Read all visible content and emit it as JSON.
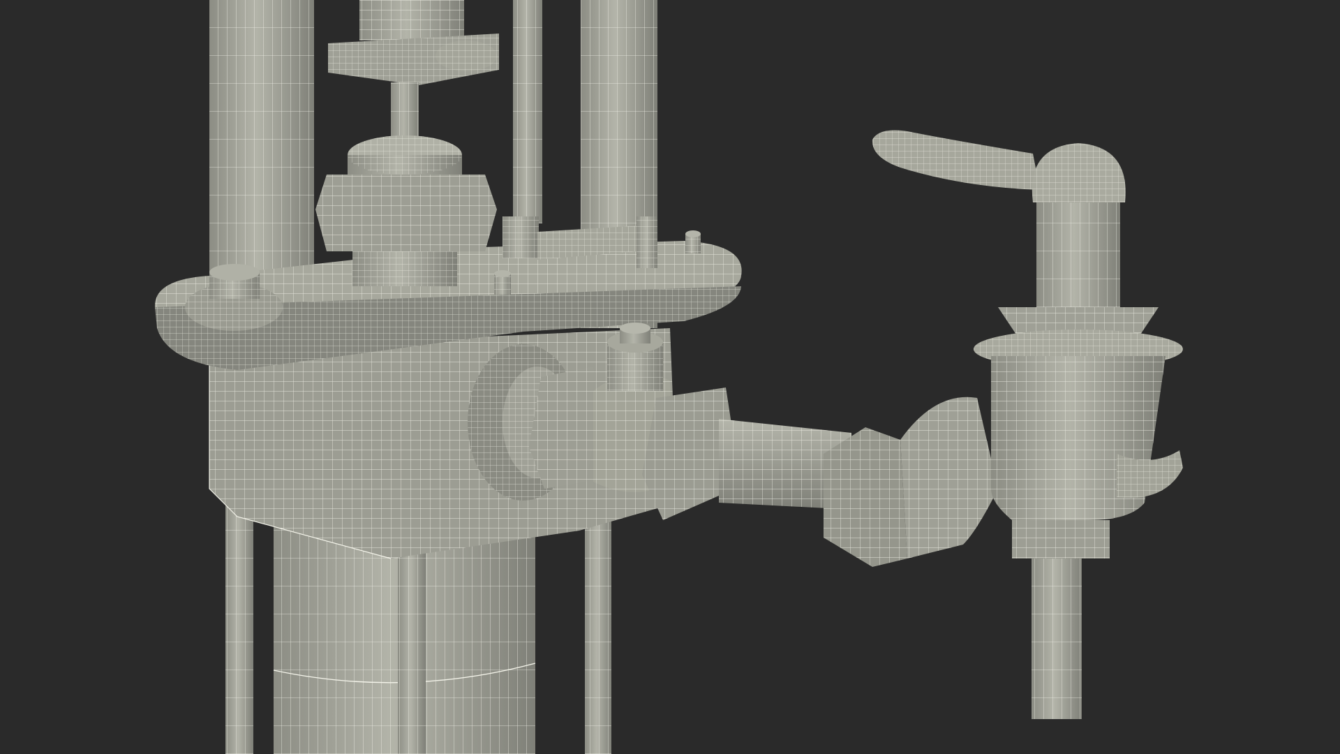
{
  "scene": {
    "background_color": "#2a2a2a",
    "surface_color": "#a9aa9f",
    "shade_color": "#8f9086",
    "wire_color": "#f2f2e9",
    "subject": "wireframe-3d-pump-valve-render"
  }
}
